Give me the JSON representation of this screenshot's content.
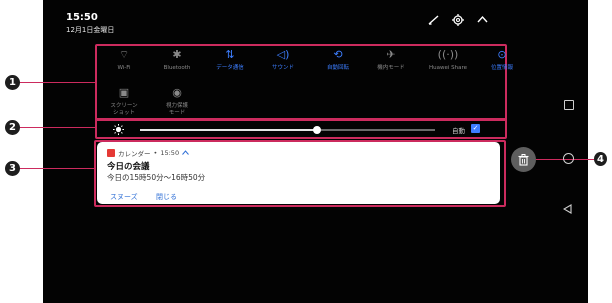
{
  "status": {
    "time": "15:50",
    "date": "12月1日金曜日"
  },
  "top_icons": [
    "edit-icon",
    "gear-icon",
    "chevron-up-icon"
  ],
  "quick_toggles": [
    {
      "label": "Wi-Fi",
      "icon": "wifi-icon",
      "active": false
    },
    {
      "label": "Bluetooth",
      "icon": "bluetooth-icon",
      "active": false
    },
    {
      "label": "データ通信",
      "icon": "mobile-data-icon",
      "active": true
    },
    {
      "label": "サウンド",
      "icon": "sound-icon",
      "active": true
    },
    {
      "label": "自動回転",
      "icon": "auto-rotate-icon",
      "active": true
    },
    {
      "label": "機内モード",
      "icon": "airplane-icon",
      "active": false
    },
    {
      "label": "Huawei Share",
      "icon": "huawei-share-icon",
      "active": false
    },
    {
      "label": "位置情報",
      "icon": "location-icon",
      "active": true
    },
    {
      "label": "スクリーン\nショット",
      "icon": "screenshot-icon",
      "active": false
    },
    {
      "label": "視力保護\nモード",
      "icon": "eye-comfort-icon",
      "active": false
    }
  ],
  "brightness": {
    "level": 0.6,
    "auto_label": "自動",
    "auto_checked": true
  },
  "notification": {
    "app": "カレンダー",
    "time": "15:50",
    "title": "今日の会議",
    "body": "今日の15時50分～16時50分",
    "actions": [
      "スヌーズ",
      "閉じる"
    ]
  },
  "callouts": [
    "1",
    "2",
    "3",
    "4"
  ],
  "colors": {
    "accent": "#3d7eff",
    "callout": "#cc2b5e"
  }
}
